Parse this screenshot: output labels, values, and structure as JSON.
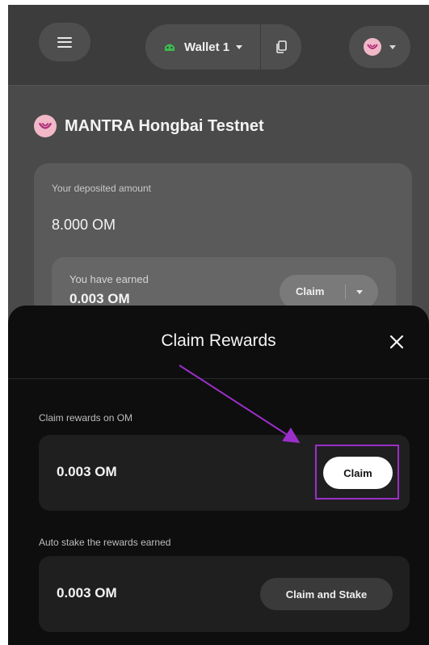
{
  "header": {
    "wallet_name": "Wallet 1",
    "menu_icon": "hamburger-icon",
    "copy_icon": "copy-icon",
    "network_icon": "mantra-logo-icon"
  },
  "network": {
    "name": "MANTRA Hongbai Testnet"
  },
  "deposit": {
    "label": "Your deposited amount",
    "value": "8.000 OM",
    "earned_label": "You have earned",
    "earned_value": "0.003 OM",
    "claim_label": "Claim"
  },
  "modal": {
    "title": "Claim Rewards",
    "claim_section_label": "Claim rewards on OM",
    "claim_amount": "0.003 OM",
    "claim_button": "Claim",
    "stake_section_label": "Auto stake the rewards earned",
    "stake_amount": "0.003 OM",
    "stake_button": "Claim and Stake"
  },
  "colors": {
    "accent": "#9b2fc9",
    "brand_pink": "#f1b8c8",
    "wallet_green": "#3fb950"
  }
}
